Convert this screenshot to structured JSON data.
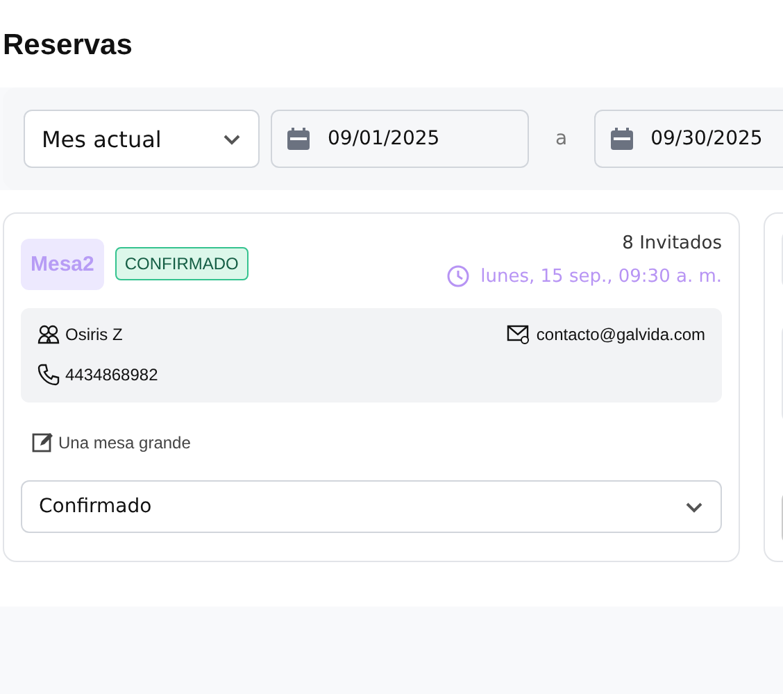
{
  "title": "Reservas",
  "filters": {
    "period": "Mes actual",
    "date_from": "09/01/2025",
    "separator": "a",
    "date_to": "09/30/2025"
  },
  "reservations": [
    {
      "table": "Mesa2",
      "badge": "CONFIRMADO",
      "guests": "8 Invitados",
      "datetime": "lunes, 15 sep., 09:30 a. m.",
      "contact_name": "Osiris Z",
      "email": "contacto@galvida.com",
      "phone": "4434868982",
      "note": "Una mesa grande",
      "status": "Confirmado"
    },
    {
      "kind": "cut"
    }
  ]
}
